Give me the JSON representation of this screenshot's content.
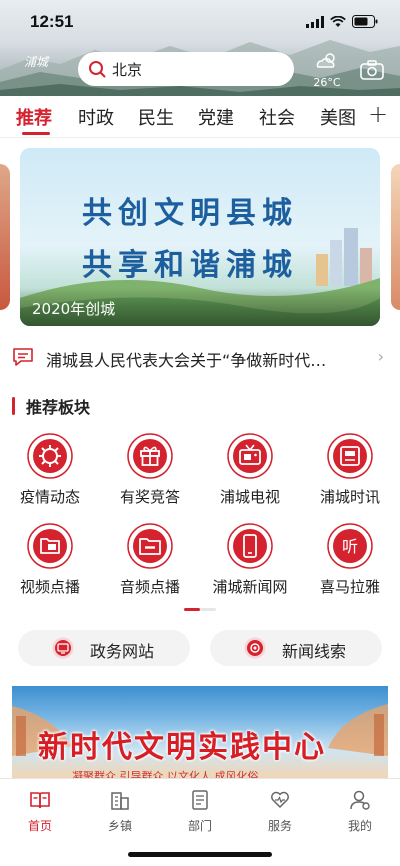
{
  "status": {
    "time": "12:51"
  },
  "header": {
    "logo_text": "浦城",
    "search_value": "北京",
    "weather_temp": "26°C"
  },
  "tabs": {
    "items": [
      "推荐",
      "时政",
      "民生",
      "党建",
      "社会",
      "美图"
    ],
    "active": "推荐",
    "plus": "+"
  },
  "banner": {
    "line1": "共创文明县城",
    "line2": "共享和谐浦城",
    "caption": "2020年创城"
  },
  "notice": {
    "text": "浦城县人民代表大会关于“争做新时代…",
    "arrow": "›"
  },
  "section": {
    "title": "推荐板块"
  },
  "grid": [
    {
      "label": "疫情动态",
      "icon": "virus-icon"
    },
    {
      "label": "有奖竞答",
      "icon": "gift-icon"
    },
    {
      "label": "浦城电视",
      "icon": "tv-icon"
    },
    {
      "label": "浦城时讯",
      "icon": "news-icon"
    },
    {
      "label": "视频点播",
      "icon": "video-icon"
    },
    {
      "label": "音频点播",
      "icon": "audio-icon"
    },
    {
      "label": "浦城新闻网",
      "icon": "phone-icon"
    },
    {
      "label": "喜马拉雅",
      "icon": "listen-icon"
    }
  ],
  "pills": [
    {
      "label": "政务网站",
      "icon": "monitor-icon"
    },
    {
      "label": "新闻线索",
      "icon": "camera-lens-icon"
    }
  ],
  "promo": {
    "title": "新时代文明实践中心",
    "subtitle": "凝聚群众 引导群众 以文化人 成风化俗"
  },
  "tabbar": {
    "items": [
      {
        "label": "首页",
        "icon": "book-icon"
      },
      {
        "label": "乡镇",
        "icon": "building-icon"
      },
      {
        "label": "部门",
        "icon": "document-icon"
      },
      {
        "label": "服务",
        "icon": "heart-hand-icon"
      },
      {
        "label": "我的",
        "icon": "user-icon"
      }
    ],
    "active": "首页"
  },
  "colors": {
    "accent": "#d4232f",
    "banner_text": "#1d5f9e"
  }
}
